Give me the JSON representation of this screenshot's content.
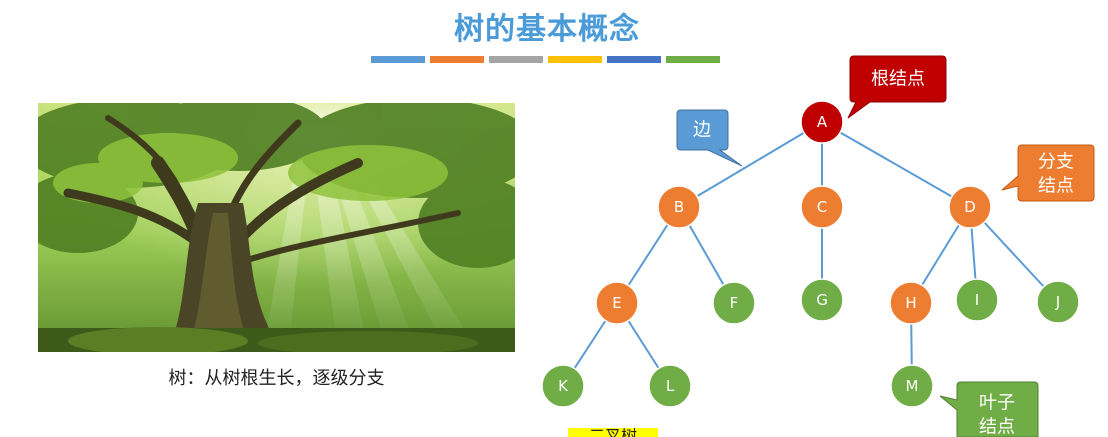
{
  "title": "树的基本概念",
  "color_strip": [
    "#5b9bd5",
    "#ed7d31",
    "#a5a5a5",
    "#ffc000",
    "#4472c4",
    "#70ad47"
  ],
  "photo": {
    "caption": "树：从树根生长，逐级分支"
  },
  "tree": {
    "colors": {
      "root": "#c00000",
      "branch": "#ed7d31",
      "leaf": "#70ad47",
      "edge": "#5b9bd5"
    },
    "nodes": [
      {
        "id": "A",
        "label": "A",
        "kind": "root"
      },
      {
        "id": "B",
        "label": "B",
        "kind": "branch"
      },
      {
        "id": "C",
        "label": "C",
        "kind": "branch"
      },
      {
        "id": "D",
        "label": "D",
        "kind": "branch"
      },
      {
        "id": "E",
        "label": "E",
        "kind": "branch"
      },
      {
        "id": "F",
        "label": "F",
        "kind": "leaf"
      },
      {
        "id": "G",
        "label": "G",
        "kind": "leaf"
      },
      {
        "id": "H",
        "label": "H",
        "kind": "branch"
      },
      {
        "id": "I",
        "label": "I",
        "kind": "leaf"
      },
      {
        "id": "J",
        "label": "J",
        "kind": "leaf"
      },
      {
        "id": "K",
        "label": "K",
        "kind": "leaf"
      },
      {
        "id": "L",
        "label": "L",
        "kind": "leaf"
      },
      {
        "id": "M",
        "label": "M",
        "kind": "leaf"
      }
    ],
    "edges": [
      [
        "A",
        "B"
      ],
      [
        "A",
        "C"
      ],
      [
        "A",
        "D"
      ],
      [
        "B",
        "E"
      ],
      [
        "B",
        "F"
      ],
      [
        "C",
        "G"
      ],
      [
        "D",
        "H"
      ],
      [
        "D",
        "I"
      ],
      [
        "D",
        "J"
      ],
      [
        "E",
        "K"
      ],
      [
        "E",
        "L"
      ],
      [
        "H",
        "M"
      ]
    ]
  },
  "callouts": {
    "root": {
      "text": "根结点",
      "color": "#c00000"
    },
    "edge": {
      "text": "边",
      "color": "#5b9bd5"
    },
    "branch": {
      "line1": "分支",
      "line2": "结点",
      "color": "#ed7d31"
    },
    "leaf": {
      "line1": "叶子",
      "line2": "结点",
      "color": "#70ad47"
    }
  },
  "footer": {
    "text": "二叉树"
  }
}
